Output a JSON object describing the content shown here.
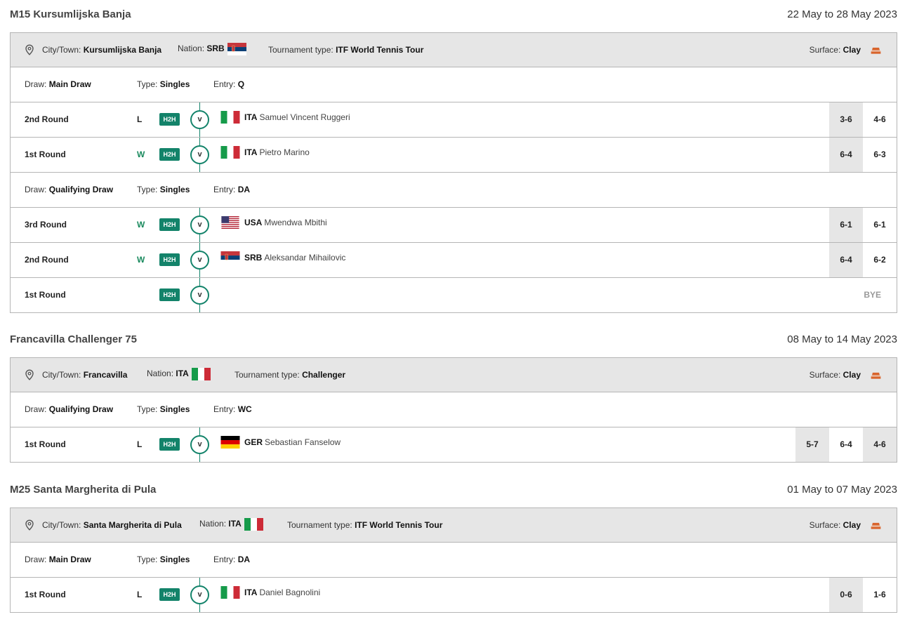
{
  "labels": {
    "city": "City/Town:",
    "nation": "Nation:",
    "ttype": "Tournament type:",
    "surface": "Surface:",
    "draw": "Draw:",
    "type": "Type:",
    "entry": "Entry:",
    "h2h": "H2H",
    "vs": "v",
    "bye": "BYE"
  },
  "colors": {
    "accent": "#13836a",
    "win": "#1a8a5e",
    "clay": "#d9632b",
    "bar": "#e6e6e6"
  },
  "t1": {
    "name": "M15 Kursumlijska Banja",
    "dates": "22 May to 28 May 2023",
    "city": "Kursumlijska Banja",
    "nation": "SRB",
    "ttype": "ITF World Tennis Tour",
    "surface": "Clay",
    "draw1": {
      "draw": "Main Draw",
      "type": "Singles",
      "entry": "Q"
    },
    "m1": {
      "round": "2nd Round",
      "result": "L",
      "code": "ITA",
      "name": "Samuel Vincent Ruggeri",
      "s1": "3-6",
      "s2": "4-6"
    },
    "m2": {
      "round": "1st Round",
      "result": "W",
      "code": "ITA",
      "name": "Pietro Marino",
      "s1": "6-4",
      "s2": "6-3"
    },
    "draw2": {
      "draw": "Qualifying Draw",
      "type": "Singles",
      "entry": "DA"
    },
    "m3": {
      "round": "3rd Round",
      "result": "W",
      "code": "USA",
      "name": "Mwendwa Mbithi",
      "s1": "6-1",
      "s2": "6-1"
    },
    "m4": {
      "round": "2nd Round",
      "result": "W",
      "code": "SRB",
      "name": "Aleksandar Mihailovic",
      "s1": "6-4",
      "s2": "6-2"
    },
    "m5": {
      "round": "1st Round"
    }
  },
  "t2": {
    "name": "Francavilla Challenger 75",
    "dates": "08 May to 14 May 2023",
    "city": "Francavilla",
    "nation": "ITA",
    "ttype": "Challenger",
    "surface": "Clay",
    "draw1": {
      "draw": "Qualifying Draw",
      "type": "Singles",
      "entry": "WC"
    },
    "m1": {
      "round": "1st Round",
      "result": "L",
      "code": "GER",
      "name": "Sebastian Fanselow",
      "s1": "5-7",
      "s2": "6-4",
      "s3": "4-6"
    }
  },
  "t3": {
    "name": "M25 Santa Margherita di Pula",
    "dates": "01 May to 07 May 2023",
    "city": "Santa Margherita di Pula",
    "nation": "ITA",
    "ttype": "ITF World Tennis Tour",
    "surface": "Clay",
    "draw1": {
      "draw": "Main Draw",
      "type": "Singles",
      "entry": "DA"
    },
    "m1": {
      "round": "1st Round",
      "result": "L",
      "code": "ITA",
      "name": "Daniel Bagnolini",
      "s1": "0-6",
      "s2": "1-6"
    }
  }
}
